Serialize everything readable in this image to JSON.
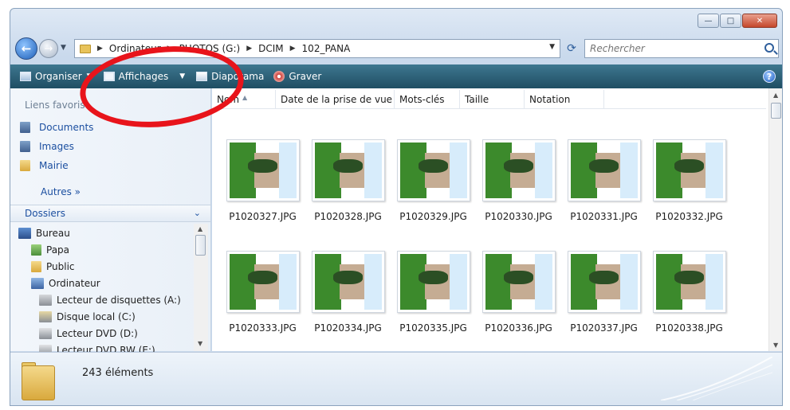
{
  "window": {
    "controls": {
      "minimize": "—",
      "maximize": "□",
      "close": "✕"
    }
  },
  "address": {
    "crumbs": [
      "Ordinateur",
      "PHOTOS (G:)",
      "DCIM",
      "102_PANA"
    ],
    "search_placeholder": "Rechercher"
  },
  "toolbar": {
    "organize": "Organiser",
    "views": "Affichages",
    "slideshow": "Diaporama",
    "burn": "Graver",
    "help": "?"
  },
  "sidebar": {
    "favorites_header": "Liens favoris",
    "favorites": [
      "Documents",
      "Images",
      "Mairie"
    ],
    "more": "Autres »",
    "folders_header": "Dossiers",
    "tree": [
      {
        "label": "Bureau",
        "icon": "desktop-icon"
      },
      {
        "label": "Papa",
        "icon": "user-folder-icon"
      },
      {
        "label": "Public",
        "icon": "folder-icon"
      },
      {
        "label": "Ordinateur",
        "icon": "computer-icon"
      },
      {
        "label": "Lecteur de disquettes (A:)",
        "icon": "floppy-drive-icon"
      },
      {
        "label": "Disque local (C:)",
        "icon": "hard-drive-icon"
      },
      {
        "label": "Lecteur DVD (D:)",
        "icon": "dvd-drive-icon"
      },
      {
        "label": "Lecteur DVD RW (E:)",
        "icon": "dvd-rw-drive-icon"
      }
    ]
  },
  "columns": [
    "Nom",
    "Date de la prise de vue",
    "Mots-clés",
    "Taille",
    "Notation"
  ],
  "files": [
    "P1020327.JPG",
    "P1020328.JPG",
    "P1020329.JPG",
    "P1020330.JPG",
    "P1020331.JPG",
    "P1020332.JPG",
    "P1020333.JPG",
    "P1020334.JPG",
    "P1020335.JPG",
    "P1020336.JPG",
    "P1020337.JPG",
    "P1020338.JPG"
  ],
  "status": {
    "count": "243 éléments"
  },
  "colors": {
    "toolbar": "#2c6178",
    "link": "#1c4fa0",
    "annotation": "#e8141b"
  }
}
